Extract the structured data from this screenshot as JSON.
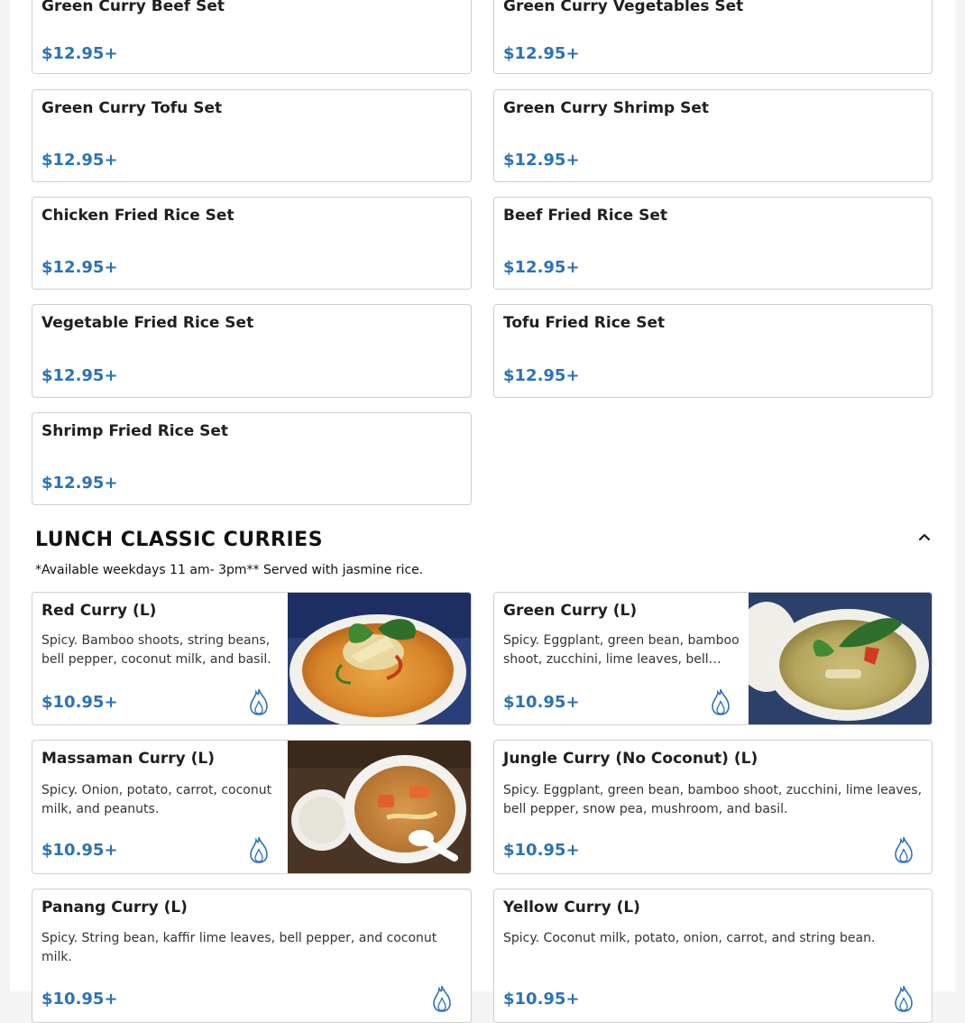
{
  "set_items": [
    {
      "name": "Green Curry Beef Set",
      "price": "$12.95+"
    },
    {
      "name": "Green Curry Vegetables Set",
      "price": "$12.95+"
    },
    {
      "name": "Green Curry Tofu Set",
      "price": "$12.95+"
    },
    {
      "name": "Green Curry Shrimp Set",
      "price": "$12.95+"
    },
    {
      "name": "Chicken Fried Rice Set",
      "price": "$12.95+"
    },
    {
      "name": "Beef Fried Rice Set",
      "price": "$12.95+"
    },
    {
      "name": "Vegetable Fried Rice Set",
      "price": "$12.95+"
    },
    {
      "name": "Tofu Fried Rice Set",
      "price": "$12.95+"
    },
    {
      "name": "Shrimp Fried Rice Set",
      "price": "$12.95+"
    }
  ],
  "section": {
    "title": "LUNCH CLASSIC CURRIES",
    "note": "*Available weekdays 11 am- 3pm** Served with jasmine rice.",
    "collapse_icon": "chevron-up-icon"
  },
  "curries": [
    {
      "name": "Red Curry (L)",
      "desc": "Spicy. Bamboo shoots, string beans, bell pepper, coconut milk, and basil.",
      "price": "$10.95+",
      "spicy_icon": "flame-icon",
      "photo": "red-curry-bowl"
    },
    {
      "name": "Green Curry (L)",
      "desc": "Spicy. Eggplant, green bean, bamboo shoot, zucchini, lime leaves, bell…",
      "price": "$10.95+",
      "spicy_icon": "flame-icon",
      "photo": "green-curry-bowl"
    },
    {
      "name": "Massaman Curry (L)",
      "desc": "Spicy. Onion, potato, carrot, coconut milk, and peanuts.",
      "price": "$10.95+",
      "spicy_icon": "flame-icon",
      "photo": "massaman-curry-bowl"
    },
    {
      "name": "Jungle Curry (No Coconut) (L)",
      "desc": "Spicy. Eggplant, green bean, bamboo shoot, zucchini, lime leaves, bell pepper, snow pea, mushroom, and basil.",
      "price": "$10.95+",
      "spicy_icon": "flame-icon"
    },
    {
      "name": "Panang Curry (L)",
      "desc": "Spicy. String bean, kaffir lime leaves, bell pepper, and coconut milk.",
      "price": "$10.95+",
      "spicy_icon": "flame-icon"
    },
    {
      "name": "Yellow Curry (L)",
      "desc": "Spicy. Coconut milk, potato, onion, carrot, and string bean.",
      "price": "$10.95+",
      "spicy_icon": "flame-icon"
    }
  ],
  "colors": {
    "price": "#2b72b8",
    "flame": "#2b72b8",
    "border": "#cfcfcf"
  }
}
